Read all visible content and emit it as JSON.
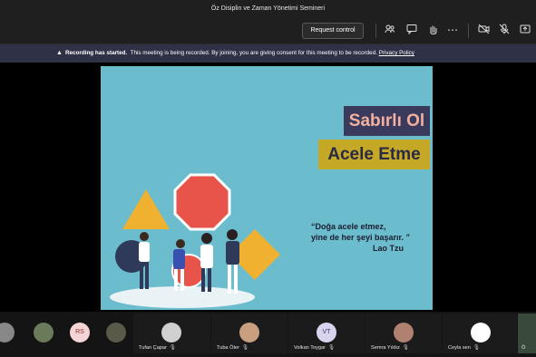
{
  "window": {
    "title": "Öz Disiplin ve Zaman Yönetimi Semineri"
  },
  "toolbar": {
    "request_control_label": "Request control",
    "icons": [
      "people-icon",
      "chat-icon",
      "raise-hand-icon",
      "more-icon",
      "camera-off-icon",
      "mic-off-icon",
      "share-icon"
    ]
  },
  "banner": {
    "title": "Recording has started.",
    "message": "This meeting is being recorded. By joining, you are giving consent for this meeting to be recorded.",
    "link": "Privacy Policy"
  },
  "slide": {
    "title1": "Sabırlı Ol",
    "title2": "Acele Etme",
    "quote_line1": "“Doğa acele etmez,",
    "quote_line2": "yine de her şeyi başarır. ”",
    "quote_author": "Lao Tzu",
    "colors": {
      "background": "#6bbccc",
      "title1_bg": "#3a3a5c",
      "title2_bg": "#c5a826"
    }
  },
  "participants": [
    {
      "name": "",
      "initials": ""
    },
    {
      "name": "",
      "initials": ""
    },
    {
      "name": "",
      "initials": "RS"
    },
    {
      "name": "",
      "initials": ""
    },
    {
      "name": "Tufan Çapar",
      "initials": ""
    },
    {
      "name": "Tuba Öter",
      "initials": ""
    },
    {
      "name": "Volkan Toygar",
      "initials": "VT"
    },
    {
      "name": "Semra Yıldız",
      "initials": ""
    },
    {
      "name": "Ceyla sen",
      "initials": ""
    },
    {
      "name": "Ö",
      "initials": ""
    }
  ]
}
